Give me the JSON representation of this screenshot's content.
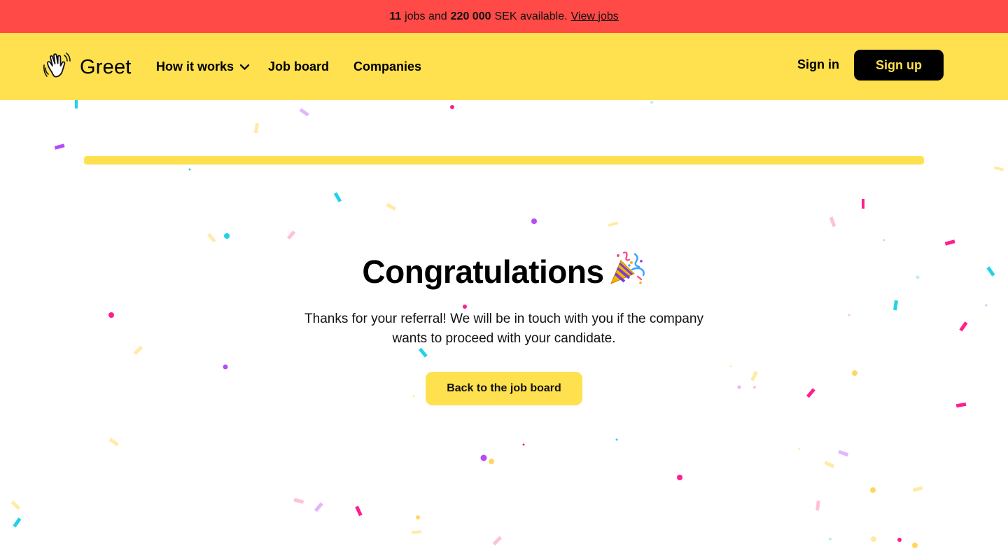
{
  "announcement": {
    "jobs_count": "11",
    "jobs_text": "jobs and",
    "amount": "220 000",
    "amount_text": "SEK available.",
    "link_label": "View jobs",
    "background": "#ff4a47"
  },
  "header": {
    "brand": "Greet",
    "logo_icon": "waving-hand-icon",
    "nav": {
      "how_it_works": "How it works",
      "job_board": "Job board",
      "companies": "Companies"
    },
    "sign_in": "Sign in",
    "sign_up": "Sign up",
    "background": "#ffe04e"
  },
  "progress": {
    "value": 1.0,
    "color": "#ffe04e"
  },
  "main": {
    "title": "Congratulations",
    "title_icon": "party-popper-icon",
    "message": "Thanks for your referral! We will be in touch with you if the company wants to proceed with your candidate.",
    "back_button": "Back to the job board"
  },
  "confetti_colors": [
    "#ff1f8e",
    "#23d2e8",
    "#b54cf5",
    "#ffd760",
    "#ffc0d9",
    "#ffeaa8",
    "#e2b6ff"
  ]
}
